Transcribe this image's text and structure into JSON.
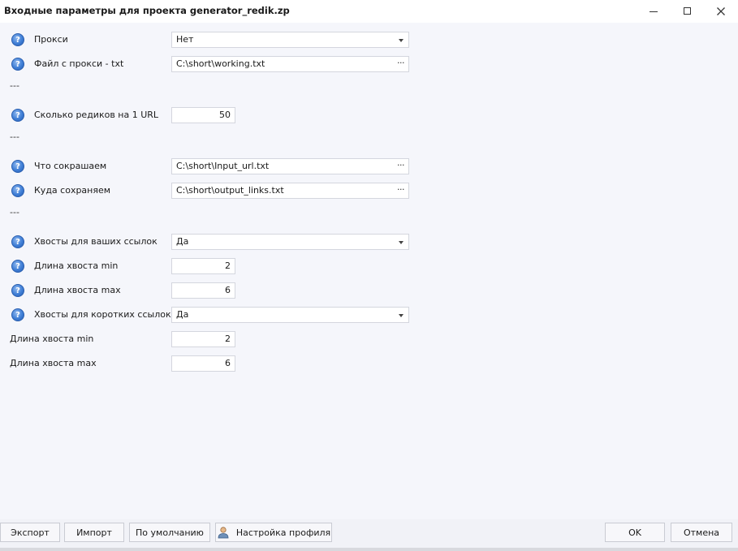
{
  "window": {
    "title": "Входные параметры для проекта generator_redik.zp",
    "minimize_icon": "minimize-icon",
    "maximize_icon": "maximize-icon",
    "close_icon": "close-icon"
  },
  "help_glyph": "?",
  "params": {
    "proxy": {
      "label": "Прокси",
      "value": "Нет"
    },
    "proxy_file": {
      "label": "Файл с прокси - txt",
      "value": "C:\\short\\working.txt"
    },
    "sep1": "---",
    "rediks_per_url": {
      "label": "Сколько редиков на 1 URL",
      "value": "50"
    },
    "sep2": "---",
    "shorten_what": {
      "label": "Что сокрашаем",
      "value": "C:\\short\\Input_url.txt"
    },
    "save_where": {
      "label": "Куда сохраняем",
      "value": "C:\\short\\output_links.txt"
    },
    "sep3": "---",
    "tails_your_links": {
      "label": "Хвосты для ваших ссылок",
      "value": "Да"
    },
    "tail_min_1": {
      "label": "Длина хвоста min",
      "value": "2"
    },
    "tail_max_1": {
      "label": "Длина хвоста max",
      "value": "6"
    },
    "tails_short_links": {
      "label": "Хвосты для коротких ссылок",
      "value": "Да"
    },
    "tail_min_2": {
      "label": "Длина хвоста min",
      "value": "2"
    },
    "tail_max_2": {
      "label": "Длина хвоста max",
      "value": "6"
    }
  },
  "ellipsis": "···",
  "footer": {
    "export": "Экспорт",
    "import": "Импорт",
    "defaults": "По умолчанию",
    "profile": "Настройка профиля",
    "ok": "OK",
    "cancel": "Отмена"
  }
}
